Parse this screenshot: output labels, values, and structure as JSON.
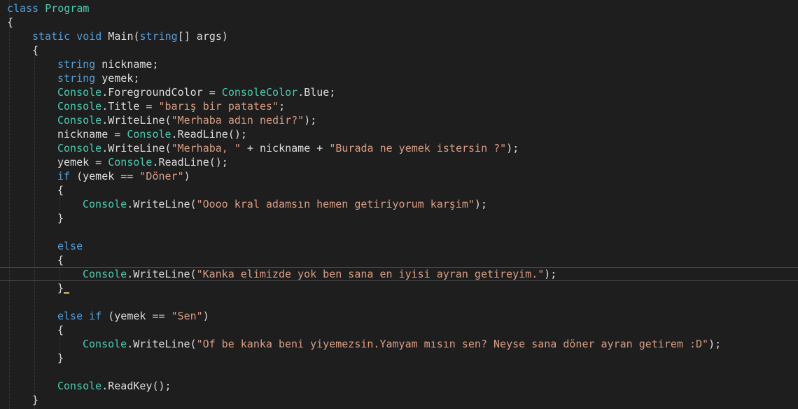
{
  "editor": {
    "language": "C#",
    "colors": {
      "background": "#1e1e1e",
      "keyword": "#569cd6",
      "type": "#4ec9b0",
      "string": "#d69d85",
      "identifier": "#dcdcdc"
    },
    "cursor_line": 20,
    "lines": [
      {
        "indent": 0,
        "tokens": [
          {
            "t": "class",
            "c": "kw"
          },
          {
            "t": " "
          },
          {
            "t": "Program",
            "c": "type"
          }
        ]
      },
      {
        "indent": 0,
        "tokens": [
          {
            "t": "{"
          }
        ]
      },
      {
        "indent": 1,
        "tokens": [
          {
            "t": "static",
            "c": "kw"
          },
          {
            "t": " "
          },
          {
            "t": "void",
            "c": "kw"
          },
          {
            "t": " Main("
          },
          {
            "t": "string",
            "c": "kw"
          },
          {
            "t": "[] args)"
          }
        ]
      },
      {
        "indent": 1,
        "tokens": [
          {
            "t": "{"
          }
        ]
      },
      {
        "indent": 2,
        "tokens": [
          {
            "t": "string",
            "c": "kw"
          },
          {
            "t": " nickname;"
          }
        ]
      },
      {
        "indent": 2,
        "tokens": [
          {
            "t": "string",
            "c": "kw"
          },
          {
            "t": " yemek;"
          }
        ]
      },
      {
        "indent": 2,
        "tokens": [
          {
            "t": "Console",
            "c": "type"
          },
          {
            "t": ".ForegroundColor = "
          },
          {
            "t": "ConsoleColor",
            "c": "type"
          },
          {
            "t": ".Blue;"
          }
        ]
      },
      {
        "indent": 2,
        "tokens": [
          {
            "t": "Console",
            "c": "type"
          },
          {
            "t": ".Title = "
          },
          {
            "t": "\"barış bir patates\"",
            "c": "str"
          },
          {
            "t": ";"
          }
        ]
      },
      {
        "indent": 2,
        "tokens": [
          {
            "t": "Console",
            "c": "type"
          },
          {
            "t": ".WriteLine("
          },
          {
            "t": "\"Merhaba adın nedir?\"",
            "c": "str"
          },
          {
            "t": ");"
          }
        ]
      },
      {
        "indent": 2,
        "tokens": [
          {
            "t": "nickname = "
          },
          {
            "t": "Console",
            "c": "type"
          },
          {
            "t": ".ReadLine();"
          }
        ]
      },
      {
        "indent": 2,
        "tokens": [
          {
            "t": "Console",
            "c": "type"
          },
          {
            "t": ".WriteLine("
          },
          {
            "t": "\"Merhaba, \"",
            "c": "str"
          },
          {
            "t": " + nickname + "
          },
          {
            "t": "\"Burada ne yemek istersin ?\"",
            "c": "str"
          },
          {
            "t": ");"
          }
        ]
      },
      {
        "indent": 2,
        "tokens": [
          {
            "t": "yemek = "
          },
          {
            "t": "Console",
            "c": "type"
          },
          {
            "t": ".ReadLine();"
          }
        ]
      },
      {
        "indent": 2,
        "tokens": [
          {
            "t": "if",
            "c": "kw"
          },
          {
            "t": " (yemek == "
          },
          {
            "t": "\"Döner\"",
            "c": "str"
          },
          {
            "t": ")"
          }
        ]
      },
      {
        "indent": 2,
        "tokens": [
          {
            "t": "{"
          }
        ]
      },
      {
        "indent": 3,
        "tokens": [
          {
            "t": "Console",
            "c": "type"
          },
          {
            "t": ".WriteLine("
          },
          {
            "t": "\"Oooo kral adamsın hemen getiriyorum karşim\"",
            "c": "str"
          },
          {
            "t": ");"
          }
        ]
      },
      {
        "indent": 2,
        "tokens": [
          {
            "t": "}"
          }
        ]
      },
      {
        "indent": 0,
        "tokens": []
      },
      {
        "indent": 2,
        "tokens": [
          {
            "t": "else",
            "c": "kw"
          }
        ]
      },
      {
        "indent": 2,
        "tokens": [
          {
            "t": "{"
          }
        ]
      },
      {
        "indent": 3,
        "tokens": [
          {
            "t": "Console",
            "c": "type"
          },
          {
            "t": ".WriteLine("
          },
          {
            "t": "\"Kanka elimizde yok ben sana en iyisi ayran getireyim.\"",
            "c": "str"
          },
          {
            "t": ");"
          }
        ]
      },
      {
        "indent": 2,
        "tokens": [
          {
            "t": "}"
          }
        ],
        "cursor": true
      },
      {
        "indent": 0,
        "tokens": []
      },
      {
        "indent": 2,
        "tokens": [
          {
            "t": "else",
            "c": "kw"
          },
          {
            "t": " "
          },
          {
            "t": "if",
            "c": "kw"
          },
          {
            "t": " (yemek == "
          },
          {
            "t": "\"Sen\"",
            "c": "str"
          },
          {
            "t": ")"
          }
        ]
      },
      {
        "indent": 2,
        "tokens": [
          {
            "t": "{"
          }
        ]
      },
      {
        "indent": 3,
        "tokens": [
          {
            "t": "Console",
            "c": "type"
          },
          {
            "t": ".WriteLine("
          },
          {
            "t": "\"Of be kanka beni yiyemezsin.Yamyam mısın sen? Neyse sana döner ayran getirem :D\"",
            "c": "str"
          },
          {
            "t": ");"
          }
        ]
      },
      {
        "indent": 2,
        "tokens": [
          {
            "t": "}"
          }
        ]
      },
      {
        "indent": 0,
        "tokens": []
      },
      {
        "indent": 2,
        "tokens": [
          {
            "t": "Console",
            "c": "type"
          },
          {
            "t": ".ReadKey();"
          }
        ]
      },
      {
        "indent": 1,
        "tokens": [
          {
            "t": "}"
          }
        ]
      }
    ]
  }
}
